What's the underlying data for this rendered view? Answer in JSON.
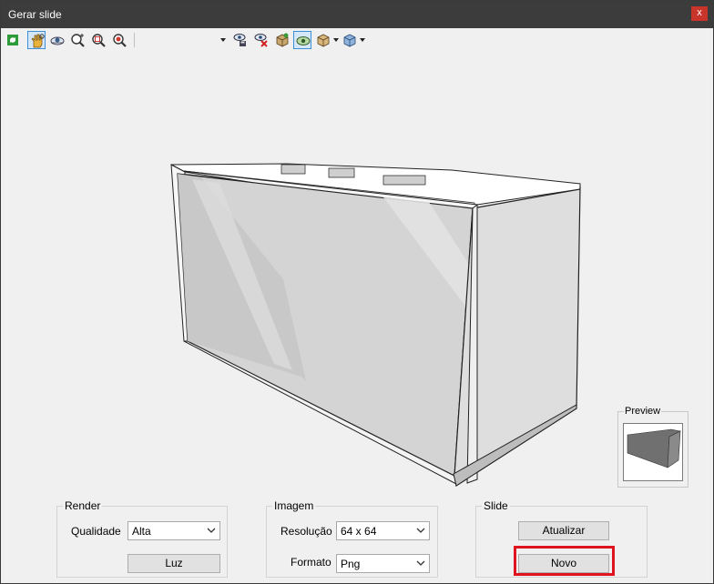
{
  "window": {
    "title": "Gerar slide",
    "close_label": "x"
  },
  "toolbar": {
    "icons": [
      "refresh-icon",
      "orbit-hand-icon",
      "pan-eye-icon",
      "zoom-in-icon",
      "zoom-window-icon",
      "zoom-extents-icon",
      "camera-save-icon",
      "camera-delete-icon",
      "camera-view-icon",
      "eye-layer-icon",
      "box-view-icon",
      "section-view-icon"
    ]
  },
  "preview": {
    "label": "Preview"
  },
  "render": {
    "title": "Render",
    "quality_label": "Qualidade",
    "quality_value": "Alta",
    "light_button": "Luz"
  },
  "image": {
    "title": "Imagem",
    "resolution_label": "Resolução",
    "resolution_value": "64 x 64",
    "format_label": "Formato",
    "format_value": "Png"
  },
  "slide": {
    "title": "Slide",
    "update_button": "Atualizar",
    "new_button": "Novo"
  },
  "colors": {
    "highlight": "#e0141e",
    "titlebar": "#3c3c3c",
    "close": "#c9342b"
  }
}
